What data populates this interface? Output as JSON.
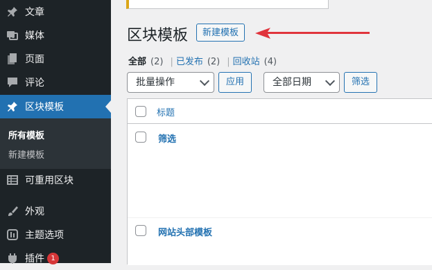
{
  "sidebar": {
    "items": [
      {
        "label": "文章",
        "icon": "pin-icon"
      },
      {
        "label": "媒体",
        "icon": "media-icon"
      },
      {
        "label": "页面",
        "icon": "page-icon"
      },
      {
        "label": "评论",
        "icon": "comment-icon"
      },
      {
        "label": "区块模板",
        "icon": "pin-icon"
      },
      {
        "label": "可重用区块",
        "icon": "table-icon"
      },
      {
        "label": "外观",
        "icon": "brush-icon"
      },
      {
        "label": "主题选项",
        "icon": "theme-options-icon"
      },
      {
        "label": "插件",
        "icon": "plugin-icon",
        "badge": "1"
      }
    ],
    "submenu": {
      "current": "所有模板",
      "add_new": "新建模板"
    }
  },
  "header": {
    "title": "区块模板",
    "add_new_label": "新建模板"
  },
  "filters": {
    "all_label": "全部",
    "all_count": "(2)",
    "published_label": "已发布",
    "published_count": "(2)",
    "trash_label": "回收站",
    "trash_count": "(4)",
    "separator": "|"
  },
  "toolbar": {
    "bulk_action": "批量操作",
    "apply_label": "应用",
    "date_filter": "全部日期",
    "filter_label": "筛选"
  },
  "table": {
    "column_title": "标题",
    "rows": [
      {
        "title": "筛选"
      },
      {
        "title": "网站头部模板"
      }
    ]
  },
  "colors": {
    "sidebar_bg": "#1d2327",
    "accent": "#2271b1",
    "arrow": "#e0343c"
  }
}
